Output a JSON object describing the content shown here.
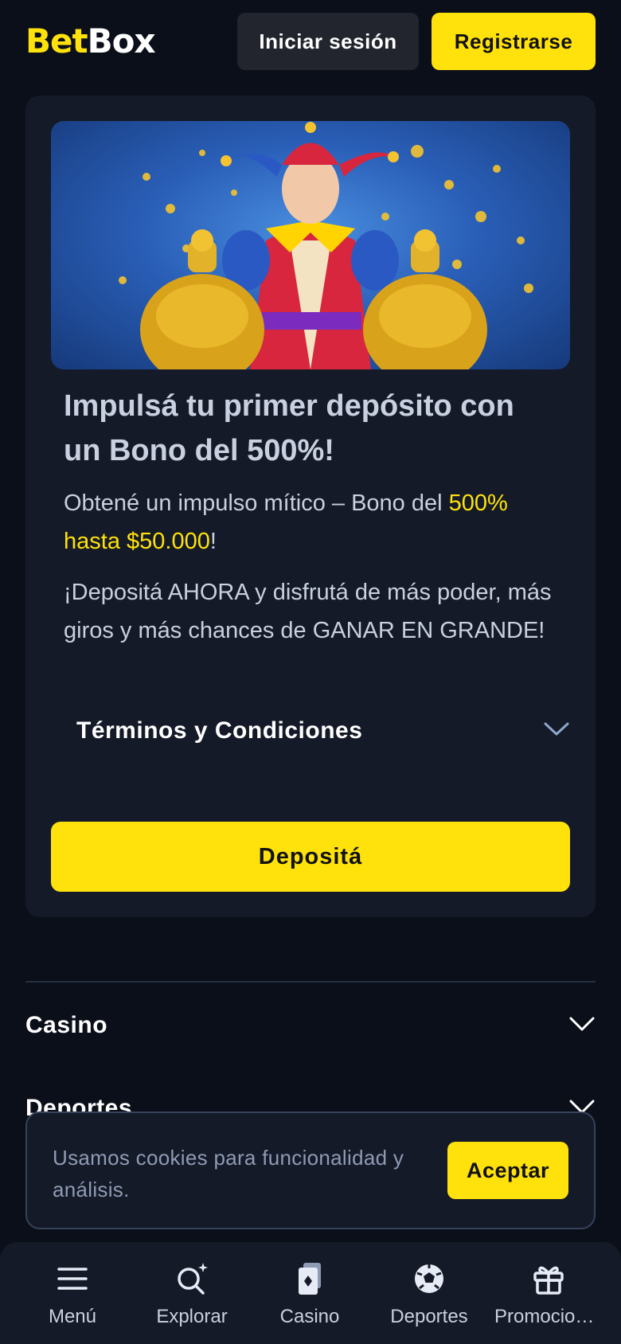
{
  "header": {
    "logo_part1": "Bet",
    "logo_part2": "Box",
    "login_label": "Iniciar sesión",
    "register_label": "Registrarse"
  },
  "promo": {
    "title": "Impulsá tu primer depósito con un Bono del 500%!",
    "text1_prefix": "Obtené un impulso mítico – Bono del ",
    "text1_highlight": "500% hasta $50.000",
    "text1_suffix": "!",
    "text2": "¡Depositá AHORA y disfrutá de más poder, más giros y más chances de GANAR EN GRANDE!",
    "terms_label": "Términos y Condiciones",
    "deposit_label": "Depositá"
  },
  "accordion": {
    "casino_label": "Casino",
    "sports_label": "Deportes"
  },
  "cookie": {
    "text": "Usamos cookies para funcionalidad y análisis.",
    "accept_label": "Aceptar"
  },
  "bottom_nav": {
    "items": [
      {
        "label": "Menú",
        "icon": "menu-icon"
      },
      {
        "label": "Explorar",
        "icon": "search-icon"
      },
      {
        "label": "Casino",
        "icon": "cards-icon"
      },
      {
        "label": "Deportes",
        "icon": "soccer-ball-icon"
      },
      {
        "label": "Promociones",
        "icon": "gift-icon"
      }
    ]
  },
  "colors": {
    "accent": "#ffe20b",
    "background": "#0b0f19",
    "card": "#141a27"
  }
}
